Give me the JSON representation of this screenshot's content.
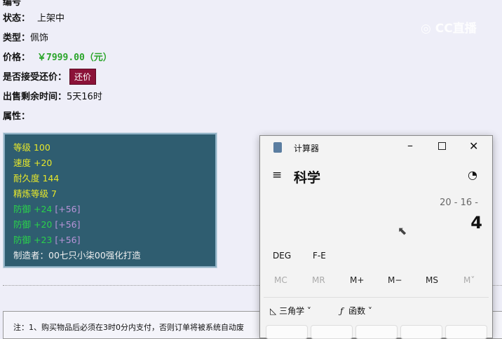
{
  "item": {
    "status_label": "状态：",
    "status": "上架中",
    "type_label": "类型：",
    "type": "佩饰",
    "price_label": "价格：",
    "price": "￥7999.00（元）",
    "bargain_label": "是否接受还价：",
    "bargain_button": "还价",
    "remaining_label": "出售剩余时间：",
    "remaining": "5天16时",
    "attr_label": "属性："
  },
  "properties": [
    {
      "text": "等级 100",
      "color": "yellow"
    },
    {
      "text": "速度 +20",
      "color": "yellow"
    },
    {
      "text": "耐久度 144",
      "color": "yellow"
    },
    {
      "text": "精炼等级 7",
      "color": "yellow"
    },
    {
      "text": "防御 +24",
      "extra": "[+56]",
      "color": "green"
    },
    {
      "text": "防御 +20",
      "extra": "[+56]",
      "color": "green"
    },
    {
      "text": "防御 +23",
      "extra": "[+56]",
      "color": "green"
    },
    {
      "text": "制造者：00七只小柒00强化打造",
      "color": "white"
    }
  ],
  "note": "注：1、购买物品后必须在3时0分内支付，否则订单将被系统自动废",
  "watermark": "CC直播",
  "calculator": {
    "title": "计算器",
    "mode": "科学",
    "expression": "20 - 16 -",
    "result": "4",
    "deg": "DEG",
    "fe": "F-E",
    "memory": [
      "MC",
      "MR",
      "M+",
      "M−",
      "MS",
      "M˅"
    ],
    "trig": "三角学",
    "func": "函数"
  }
}
